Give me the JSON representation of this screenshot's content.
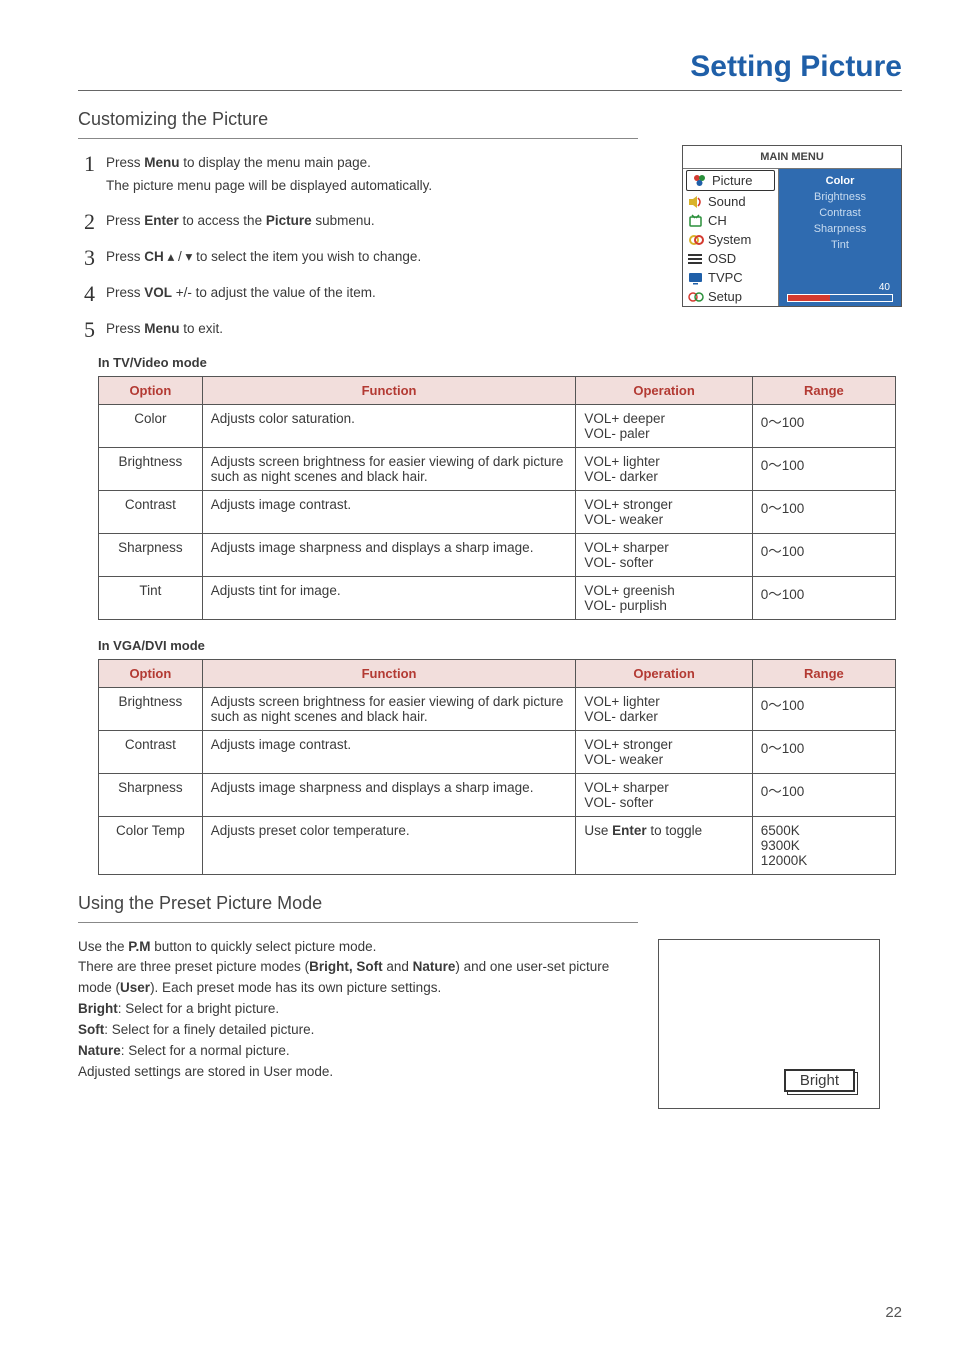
{
  "pageTitle": "Setting Picture",
  "section1": "Customizing the Picture",
  "steps": [
    {
      "num": "1",
      "text": "Press  <b>Menu</b> to display the menu main page.",
      "sub": "The picture menu page will be displayed automatically."
    },
    {
      "num": "2",
      "text": "Press <b>Enter</b> to access the <b>Picture</b> submenu."
    },
    {
      "num": "3",
      "text": "Press  <b>CH</b> ▴ / ▾  to select the item you wish to change."
    },
    {
      "num": "4",
      "text": "Press  <b>VOL</b> +/-  to adjust the value of the item."
    },
    {
      "num": "5",
      "text": "Press <b>Menu</b> to exit."
    }
  ],
  "osd": {
    "title": "MAIN MENU",
    "left": [
      "Picture",
      "Sound",
      "CH",
      "System",
      "OSD",
      "TVPC",
      "Setup"
    ],
    "right": [
      "Color",
      "Brightness",
      "Contrast",
      "Sharpness",
      "Tint"
    ],
    "barValue": "40"
  },
  "table1Label": "In TV/Video mode",
  "headers": [
    "Option",
    "Function",
    "Operation",
    "Range"
  ],
  "table1": [
    [
      "Color",
      "Adjusts color saturation.",
      "VOL+  deeper\nVOL-  paler",
      "0～100"
    ],
    [
      "Brightness",
      "Adjusts screen brightness for easier viewing of dark picture such as night scenes and black hair.",
      "VOL+  lighter\nVOL-  darker",
      "0～100"
    ],
    [
      "Contrast",
      "Adjusts image contrast.",
      "VOL+  stronger\nVOL-  weaker",
      "0～100"
    ],
    [
      "Sharpness",
      "Adjusts image sharpness and displays a sharp image.",
      "VOL+  sharper\nVOL-  softer",
      "0～100"
    ],
    [
      "Tint",
      "Adjusts tint for image.",
      "VOL+  greenish\nVOL-  purplish",
      "0～100"
    ]
  ],
  "table2Label": "In VGA/DVI mode",
  "table2": [
    [
      "Brightness",
      "Adjusts screen brightness for easier viewing of dark picture such as night scenes and black hair.",
      "VOL+  lighter\nVOL-  darker",
      "0～100"
    ],
    [
      "Contrast",
      "Adjusts image contrast.",
      "VOL+  stronger\nVOL-  weaker",
      "0～100"
    ],
    [
      "Sharpness",
      "Adjusts image sharpness and displays a sharp image.",
      "VOL+  sharper\nVOL-  softer",
      "0～100"
    ],
    [
      "Color Temp",
      "Adjusts preset color temperature.",
      "Use <b>Enter</b> to toggle",
      "6500K\n9300K\n12000K"
    ]
  ],
  "section2": "Using the Preset Picture Mode",
  "preset": {
    "lines": [
      "Use the <b>P.M</b> button to quickly select picture mode.",
      "There are three preset picture modes (<b>Bright, Soft</b> and <b>Nature</b>) and one user-set picture mode (<b>User</b>). Each preset mode has its own picture settings.",
      "<b>Bright</b>: Select for a bright picture.",
      "<b>Soft</b>: Select for a finely detailed picture.",
      "<b>Nature</b>: Select for a normal picture.",
      "Adjusted settings are stored in User mode."
    ],
    "badge": "Bright"
  },
  "pageNumber": "22"
}
